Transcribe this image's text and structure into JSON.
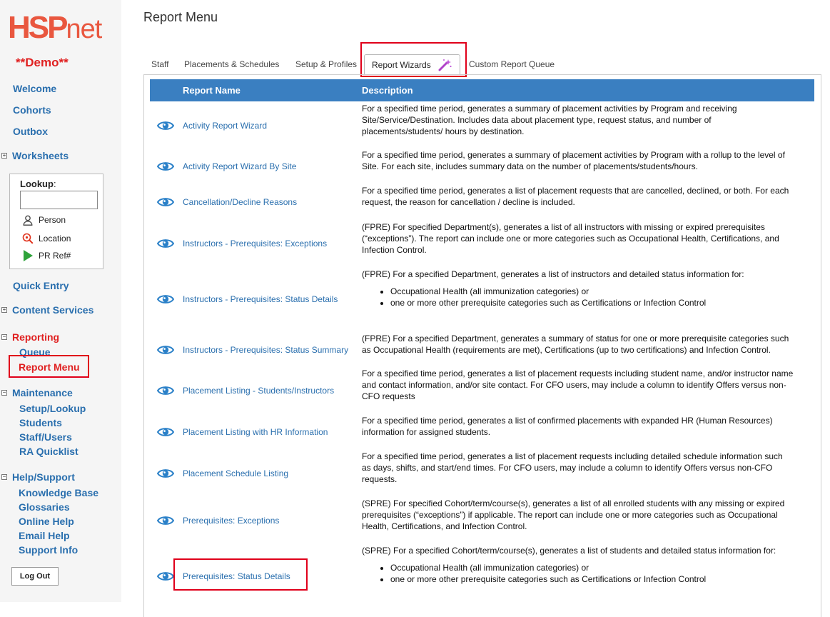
{
  "brand": {
    "logo_main": "HSP",
    "logo_suffix": "net",
    "env_badge": "**Demo**"
  },
  "sidebar": {
    "welcome": "Welcome",
    "cohorts": "Cohorts",
    "outbox": "Outbox",
    "worksheets": "Worksheets",
    "lookup": {
      "label": "Lookup",
      "colon": ":",
      "input_value": "",
      "person": "Person",
      "location": "Location",
      "pr_ref": "PR Ref#"
    },
    "quick_entry": "Quick Entry",
    "content_services": "Content Services",
    "reporting": {
      "title": "Reporting",
      "queue": "Queue",
      "report_menu": "Report Menu"
    },
    "maintenance": {
      "title": "Maintenance",
      "setup_lookup": "Setup/Lookup",
      "students": "Students",
      "staff_users": "Staff/Users",
      "ra_quicklist": "RA Quicklist"
    },
    "help": {
      "title": "Help/Support",
      "knowledge_base": "Knowledge Base",
      "glossaries": "Glossaries",
      "online_help": "Online Help",
      "email_help": "Email Help",
      "support_info": "Support Info"
    },
    "logout": "Log Out"
  },
  "page": {
    "title": "Report Menu"
  },
  "tabs": [
    {
      "label": "Staff"
    },
    {
      "label": "Placements & Schedules"
    },
    {
      "label": "Setup & Profiles"
    },
    {
      "label": "Report Wizards"
    },
    {
      "label": "Custom Report Queue"
    }
  ],
  "table": {
    "col_name": "Report Name",
    "col_desc": "Description",
    "rows": [
      {
        "name": "Activity Report Wizard",
        "desc": "For a specified time period, generates a summary of placement activities by Program and receiving Site/Service/Destination. Includes data about placement type, request status, and number of placements/students/ hours by destination."
      },
      {
        "name": "Activity Report Wizard By Site",
        "desc": "For a specified time period, generates a summary of placement activities by Program with a rollup to the level of Site. For each site, includes summary data on the number of placements/students/hours."
      },
      {
        "name": "Cancellation/Decline Reasons",
        "desc": "For a specified time period, generates a list of placement requests that are cancelled, declined, or both. For each request, the reason for cancellation / decline is included."
      },
      {
        "name": "Instructors - Prerequisites: Exceptions",
        "desc": "(FPRE) For specified Department(s), generates a list of all instructors with missing or expired prerequisites (“exceptions”). The report can include one or more categories such as Occupational Health, Certifications, and Infection Control."
      },
      {
        "name": "Instructors - Prerequisites: Status Details",
        "desc": "(FPRE) For a specified Department, generates a list of instructors and detailed status information for:",
        "bullets": [
          "Occupational Health (all immunization categories) or",
          "one or more other prerequisite categories such as Certifications or Infection Control"
        ]
      },
      {
        "name": "Instructors - Prerequisites: Status Summary",
        "desc": "(FPRE) For a specified Department, generates a summary of status for one or more prerequisite categories such as Occupational Health (requirements are met), Certifications (up to two certifications) and Infection Control."
      },
      {
        "name": "Placement Listing - Students/Instructors",
        "desc": "For a specified time period, generates a list of placement requests including student name, and/or instructor name and contact information, and/or site contact. For CFO users, may include a column to identify Offers versus non-CFO requests"
      },
      {
        "name": "Placement Listing with HR Information",
        "desc": "For a specified time period, generates a list of confirmed placements with expanded HR (Human Resources) information for assigned students."
      },
      {
        "name": "Placement Schedule Listing",
        "desc": "For a specified time period, generates a list of placement requests including detailed schedule information such as days, shifts, and start/end times. For CFO users, may include a column to identify Offers versus non-CFO requests."
      },
      {
        "name": "Prerequisites: Exceptions",
        "desc": "(SPRE) For specified Cohort/term/course(s), generates a list of all enrolled students with any missing or expired prerequisites (“exceptions”) if applicable. The report can include one or more categories such as Occupational Health, Certifications, and Infection Control."
      },
      {
        "name": "Prerequisites: Status Details",
        "desc": "(SPRE) For a specified Cohort/term/course(s), generates a list of students and detailed status information for:",
        "bullets": [
          "Occupational Health (all immunization categories) or",
          "one or more other prerequisite categories such as Certifications or Infection Control"
        ]
      }
    ]
  },
  "colors": {
    "accent_blue": "#3a7fc1",
    "link_blue": "#2a6fae",
    "brand_red": "#e9573f",
    "highlight_red": "#e0001a"
  }
}
